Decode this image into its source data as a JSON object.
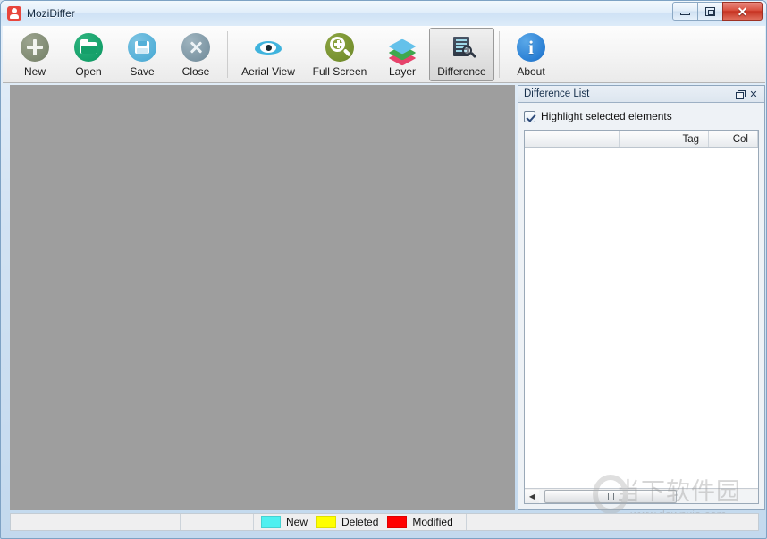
{
  "window": {
    "title": "MoziDiffer",
    "app_icon": "app-logo-icon",
    "controls": {
      "minimize": "minimize-icon",
      "maximize": "maximize-icon",
      "close": "close-icon",
      "close_glyph": "✕"
    }
  },
  "toolbar": {
    "buttons": [
      {
        "label": "New",
        "icon": "new-icon"
      },
      {
        "label": "Open",
        "icon": "open-folder-icon"
      },
      {
        "label": "Save",
        "icon": "save-disk-icon"
      },
      {
        "label": "Close",
        "icon": "close-circle-icon"
      },
      {
        "label": "Aerial View",
        "icon": "eye-icon"
      },
      {
        "label": "Full Screen",
        "icon": "magnifier-plus-icon"
      },
      {
        "label": "Layer",
        "icon": "layers-icon"
      },
      {
        "label": "Difference",
        "icon": "difference-icon"
      },
      {
        "label": "About",
        "icon": "info-icon"
      }
    ],
    "active_button": "Difference"
  },
  "canvas": {
    "background_color": "#9e9e9e"
  },
  "dock": {
    "title": "Difference List",
    "restore_button": "restore-icon",
    "close_button": "close-panel-icon",
    "close_glyph": "✕",
    "highlight": {
      "label": "Highlight selected elements",
      "checked": true
    },
    "table": {
      "columns": [
        "",
        "Tag",
        "Col"
      ],
      "rows": []
    },
    "hscroll": {
      "left_arrow": "◀",
      "right_arrow": "▶"
    }
  },
  "watermark": {
    "chinese": "当下软件园",
    "url": "www.downxia.com"
  },
  "statusbar": {
    "cells": [
      "",
      ""
    ],
    "legend": [
      {
        "label": "New",
        "color": "#4ff0f0"
      },
      {
        "label": "Deleted",
        "color": "#ffff00"
      },
      {
        "label": "Modified",
        "color": "#ff0000"
      }
    ]
  }
}
